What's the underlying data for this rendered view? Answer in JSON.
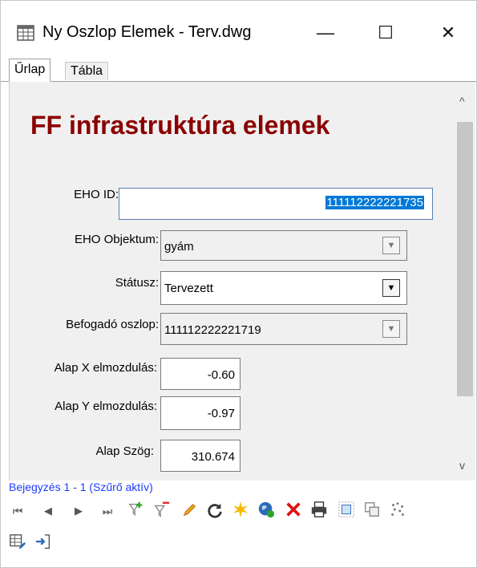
{
  "window": {
    "title": "Ny Oszlop Elemek - Terv.dwg",
    "minimize_glyph": "—",
    "maximize_glyph": "☐",
    "close_glyph": "✕",
    "icon": "table-icon"
  },
  "tabs": [
    {
      "label": "Űrlap",
      "active": true
    },
    {
      "label": "Tábla",
      "active": false
    }
  ],
  "form": {
    "heading": "FF infrastruktúra elemek",
    "fields": {
      "eho_id": {
        "label": "EHO ID:",
        "value": "111112222221735"
      },
      "eho_objektum": {
        "label": "EHO Objektum:",
        "value": "gyám"
      },
      "statusz": {
        "label": "Státusz:",
        "value": "Tervezett"
      },
      "befogado": {
        "label": "Befogadó oszlop:",
        "value": "111112222221719"
      },
      "alap_x": {
        "label": "Alap X elmozdulás:",
        "value": "-0.60"
      },
      "alap_y": {
        "label": "Alap Y elmozdulás:",
        "value": "-0.97"
      },
      "alap_szog": {
        "label": "Alap Szög:",
        "value": "310.674"
      }
    }
  },
  "status_bar": {
    "text": "Bejegyzés 1 - 1 (Szűrő aktív)"
  },
  "colors": {
    "heading": "#8b0000",
    "status": "#1a3cff",
    "selection": "#0078d7"
  }
}
